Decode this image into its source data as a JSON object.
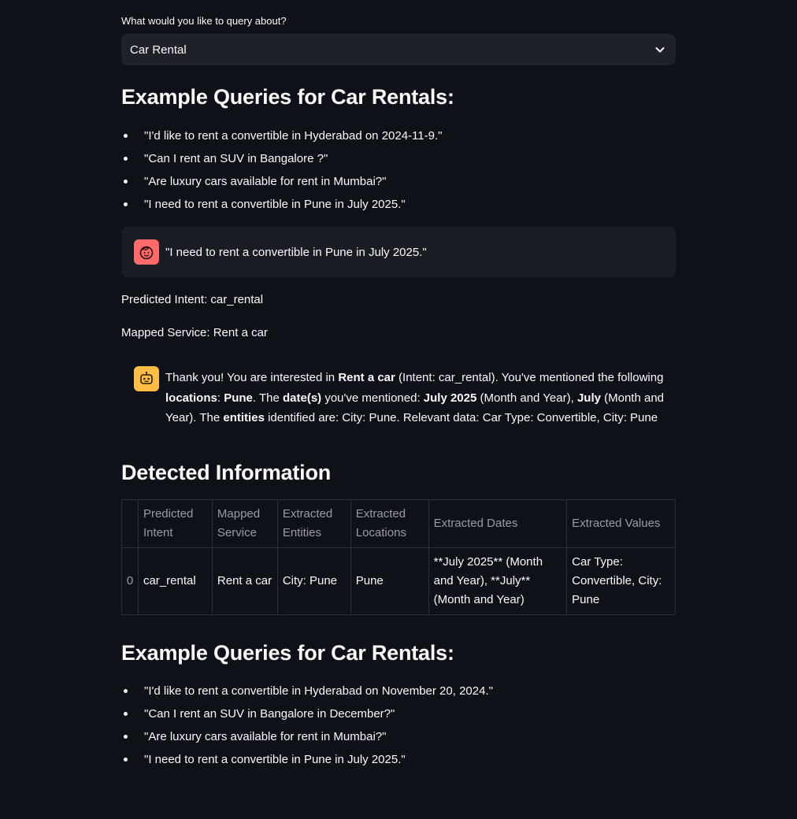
{
  "select": {
    "label": "What would you like to query about?",
    "value": "Car Rental",
    "icon": "chevron-down-icon"
  },
  "section1": {
    "heading": "Example Queries for Car Rentals:",
    "items": [
      "\"I'd like to rent a convertible in Hyderabad on 2024-11-9.\"",
      "\"Can I rent an SUV in Bangalore ?\"",
      "\"Are luxury cars available for rent in Mumbai?\"",
      "\"I need to rent a convertible in Pune in July 2025.\""
    ]
  },
  "chat": {
    "user_message": "\"I need to rent a convertible in Pune in July 2025.\"",
    "bot": {
      "t1": "Thank you! You are interested in ",
      "b1": "Rent a car",
      "t2": " (Intent: car_rental). You've mentioned the following ",
      "b2": "locations",
      "t3": ": ",
      "b3": "Pune",
      "t4": ". The ",
      "b4": "date(s)",
      "t5": " you've mentioned: ",
      "b5": "July 2025",
      "t6": " (Month and Year), ",
      "b6": "July",
      "t7": " (Month and Year). The ",
      "b7": "entities",
      "t8": " identified are: City: Pune. Relevant data: Car Type: Convertible, City: Pune"
    }
  },
  "predicted_intent": "Predicted Intent: car_rental",
  "mapped_service": "Mapped Service: Rent a car",
  "detected": {
    "heading": "Detected Information",
    "columns": [
      "",
      "Predicted Intent",
      "Mapped Service",
      "Extracted Entities",
      "Extracted Locations",
      "Extracted Dates",
      "Extracted Values"
    ],
    "rows": [
      [
        "0",
        "car_rental",
        "Rent a car",
        "City: Pune",
        "Pune",
        "**July 2025** (Month and Year), **July** (Month and Year)",
        "Car Type: Convertible, City: Pune"
      ]
    ]
  },
  "section2": {
    "heading": "Example Queries for Car Rentals:",
    "items": [
      "\"I'd like to rent a convertible in Hyderabad on November 20, 2024.\"",
      "\"Can I rent an SUV in Bangalore in December?\"",
      "\"Are luxury cars available for rent in Mumbai?\"",
      "\"I need to rent a convertible in Pune in July 2025.\""
    ]
  },
  "colors": {
    "background": "#0e1117",
    "user_avatar": "#ff6b6b",
    "bot_avatar": "#ffbd45"
  }
}
